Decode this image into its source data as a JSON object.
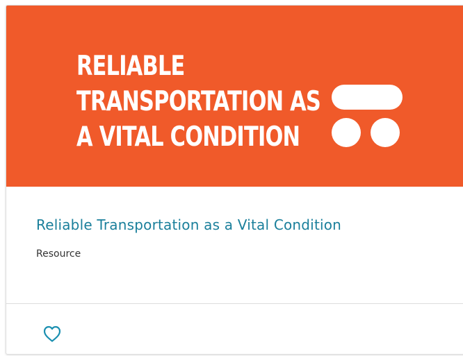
{
  "banner": {
    "lines": [
      "Reliable",
      "Transportation as",
      "a Vital Condition"
    ],
    "background_color": "#f05a2a",
    "logo_icon": "stacked-shapes-logo"
  },
  "card": {
    "title": "Reliable Transportation as a Vital Condition",
    "type": "Resource",
    "title_color": "#1a7f9b"
  },
  "footer": {
    "favorite_icon": "heart-outline-icon",
    "favorite_color": "#1a8fb0"
  }
}
